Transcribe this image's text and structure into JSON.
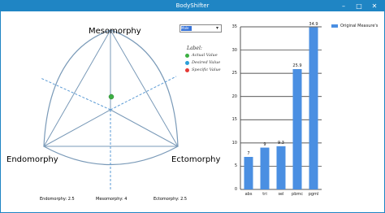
{
  "window": {
    "title": "BodyShifter"
  },
  "somatochart": {
    "labels": {
      "top": "Mesomorphy",
      "left": "Endomorphy",
      "right": "Ectomorphy"
    },
    "values": {
      "endomorphy": "Endomorphy: 2.5",
      "mesomorphy": "Mesomorphy: 4",
      "ectomorphy": "Ectomorphy: 2.5"
    },
    "point_color": "#3cb043"
  },
  "legend": {
    "title": "Label:",
    "items": [
      {
        "label": "Actual Value",
        "color": "#3cb043"
      },
      {
        "label": "Desired Value",
        "color": "#2c9fd8"
      },
      {
        "label": "Specific Value",
        "color": "#e53935"
      }
    ]
  },
  "combo": {
    "selected": "Male"
  },
  "chart_data": {
    "type": "bar",
    "categories": [
      "abs",
      "tri",
      "sel",
      "pbmc",
      "pgml"
    ],
    "series": [
      {
        "name": "Original Measure's",
        "values": [
          7,
          9,
          9.3,
          25.9,
          34.9
        ]
      }
    ],
    "value_labels": [
      "7",
      "9",
      "9.3",
      "25.9",
      "34.9"
    ],
    "yticks": [
      "0",
      "5",
      "10",
      "15",
      "20",
      "25",
      "30",
      "35"
    ],
    "ylim": [
      0,
      35
    ],
    "grid": true,
    "legend_position": "top-right",
    "bar_color": "#4a8fe2"
  }
}
